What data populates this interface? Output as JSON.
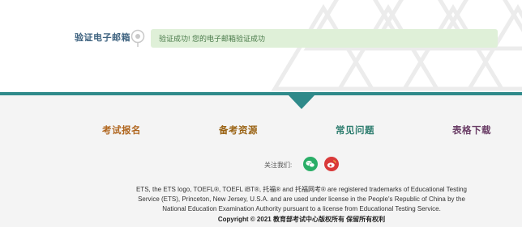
{
  "verify": {
    "label": "验证电子邮箱",
    "message": "验证成功! 您的电子邮箱验证成功"
  },
  "footer": {
    "nav": [
      {
        "label": "考试报名",
        "color": "#b0661f"
      },
      {
        "label": "备考资源",
        "color": "#9a6314"
      },
      {
        "label": "常见问题",
        "color": "#2e7d6f"
      },
      {
        "label": "表格下载",
        "color": "#6a3d66"
      }
    ],
    "follow_label": "关注我们:",
    "social": [
      {
        "icon": "wechat-icon",
        "color": "#2aae67"
      },
      {
        "icon": "weibo-icon",
        "color": "#d93a3a"
      }
    ],
    "legal_line1": "ETS, the ETS logo, TOEFL®, TOEFL iBT®, 托福® and 托福网考® are registered trademarks of Educational Testing",
    "legal_line2": "Service (ETS), Princeton, New Jersey, U.S.A. and are used under license in the People's Republic of China by the",
    "legal_line3": "National Education Examination Authority pursuant to a license from Educational Testing Service.",
    "copyright": "Copyright © 2021 教育部考试中心版权所有 保留所有权利"
  },
  "colors": {
    "accent_teal": "#2f8a8a",
    "success_bg": "#dff0d8"
  }
}
